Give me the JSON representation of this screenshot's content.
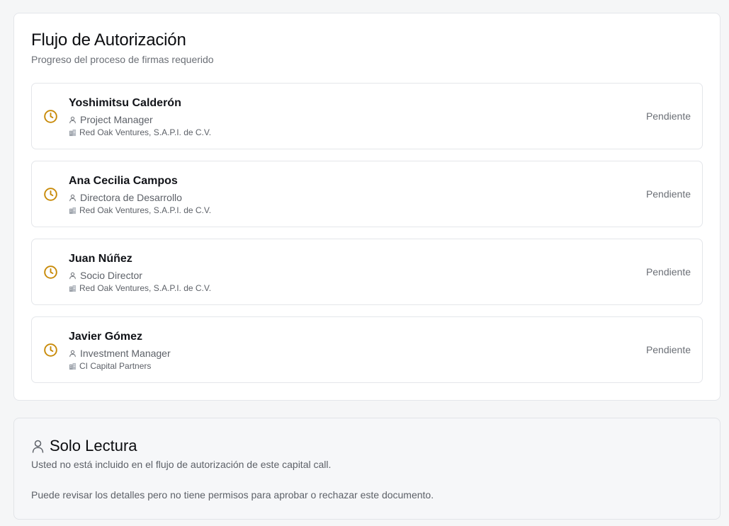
{
  "auth_flow": {
    "title": "Flujo de Autorización",
    "subtitle": "Progreso del proceso de firmas requerido",
    "status_color": "#c88a08",
    "signers": [
      {
        "name": "Yoshimitsu Calderón",
        "role": "Project Manager",
        "company": "Red Oak Ventures, S.A.P.I. de C.V.",
        "status": "Pendiente",
        "icon": "clock-icon"
      },
      {
        "name": "Ana Cecilia Campos",
        "role": "Directora de Desarrollo",
        "company": "Red Oak Ventures, S.A.P.I. de C.V.",
        "status": "Pendiente",
        "icon": "clock-icon"
      },
      {
        "name": "Juan Núñez",
        "role": "Socio Director",
        "company": "Red Oak Ventures, S.A.P.I. de C.V.",
        "status": "Pendiente",
        "icon": "clock-icon"
      },
      {
        "name": "Javier Gómez",
        "role": "Investment Manager",
        "company": "CI Capital Partners",
        "status": "Pendiente",
        "icon": "clock-icon"
      }
    ]
  },
  "read_only": {
    "icon": "user-icon",
    "title": "Solo Lectura",
    "line1": "Usted no está incluido en el flujo de autorización de este capital call.",
    "line2": "Puede revisar los detalles pero no tiene permisos para aprobar o rechazar este documento."
  }
}
